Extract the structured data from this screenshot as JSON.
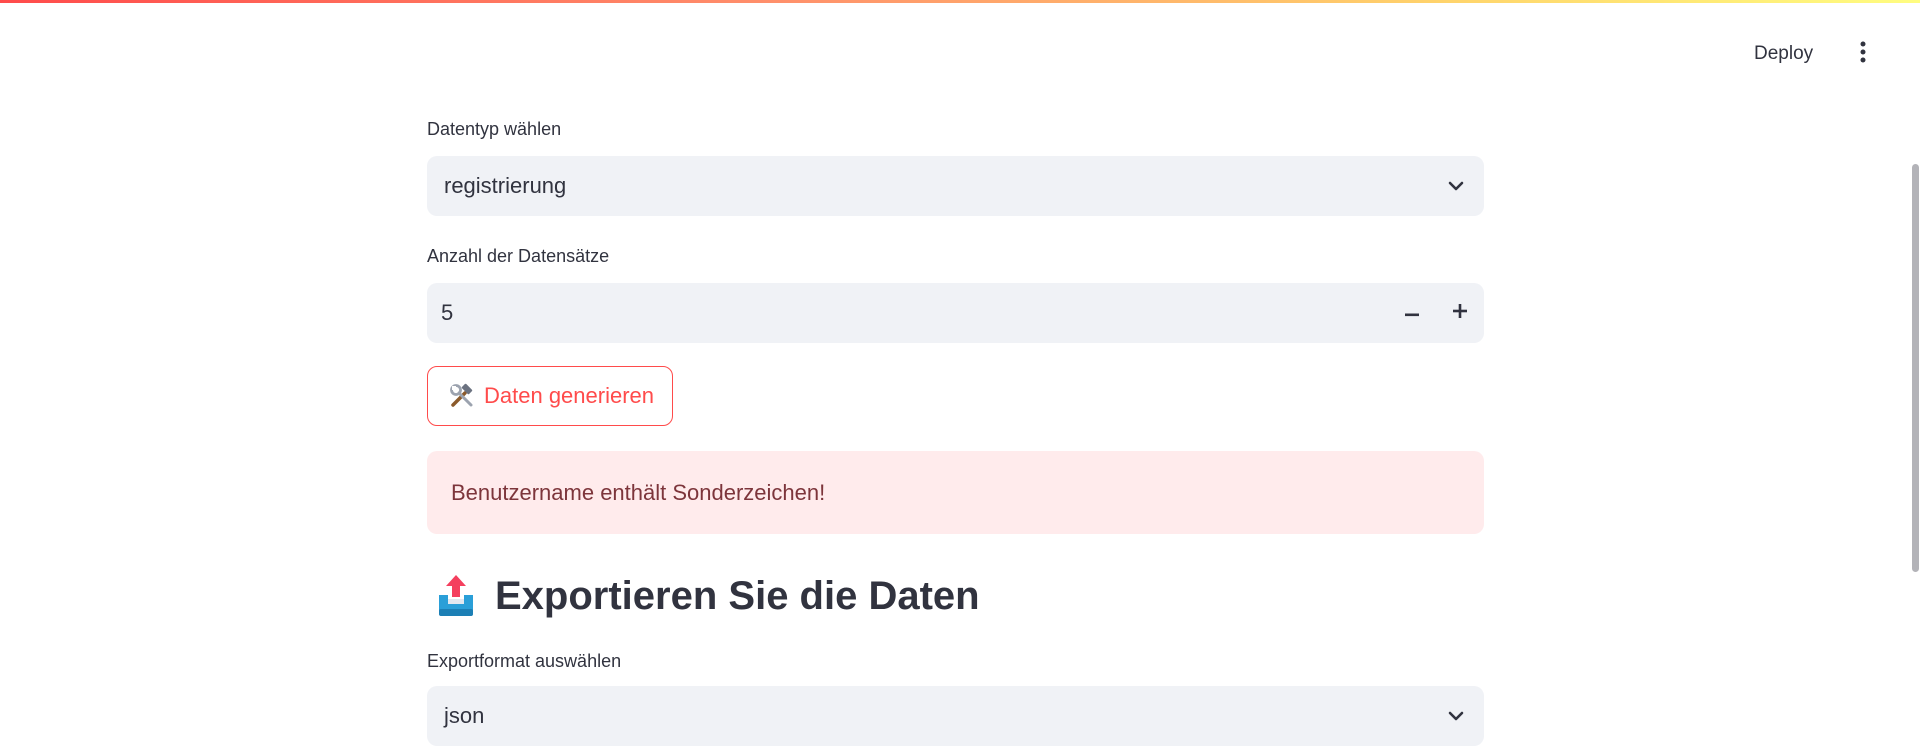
{
  "header": {
    "deploy_label": "Deploy",
    "menu_icon": "vertical-ellipsis-icon"
  },
  "colors": {
    "accent": "#ff4b4b",
    "input_bg": "#f0f2f6",
    "error_bg": "#ffebec",
    "error_text": "#7d353b",
    "text": "#31333f"
  },
  "form": {
    "datatype": {
      "label": "Datentyp wählen",
      "selected": "registrierung"
    },
    "count": {
      "label": "Anzahl der Datensätze",
      "value": "5",
      "decrement_label": "−",
      "increment_label": "+"
    },
    "generate_button": {
      "icon": "hammer-and-wrench-icon",
      "label": "Daten generieren"
    },
    "error_message": "Benutzername enthält Sonderzeichen!"
  },
  "export": {
    "heading_icon": "outbox-tray-icon",
    "heading": "Exportieren Sie die Daten",
    "format": {
      "label": "Exportformat auswählen",
      "selected": "json"
    }
  }
}
